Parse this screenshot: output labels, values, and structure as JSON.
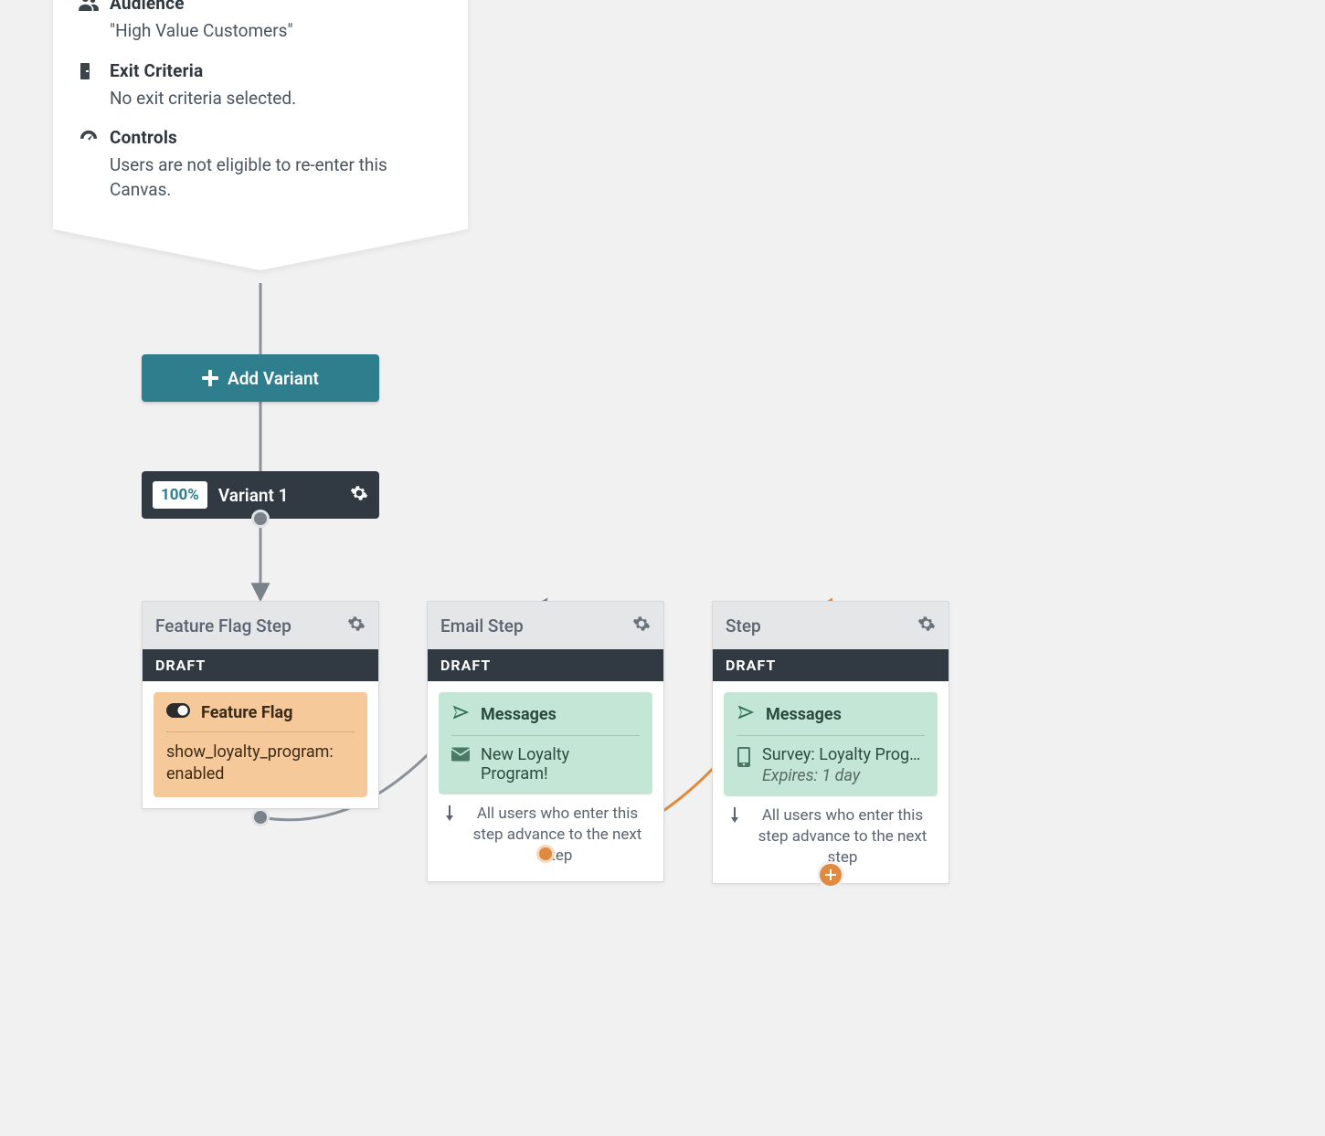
{
  "canvas": {
    "audience": {
      "label": "Audience",
      "value": "\"High Value Customers\""
    },
    "exit": {
      "label": "Exit Criteria",
      "value": "No exit criteria selected."
    },
    "controls": {
      "label": "Controls",
      "value": "Users are not eligible to re-enter this Canvas."
    }
  },
  "buttons": {
    "add_variant": "Add Variant"
  },
  "variant": {
    "percent": "100%",
    "name": "Variant 1"
  },
  "steps": {
    "feature": {
      "title": "Feature Flag Step",
      "status": "DRAFT",
      "panel_title": "Feature Flag",
      "panel_value": "show_loyalty_program: enabled"
    },
    "email": {
      "title": "Email Step",
      "status": "DRAFT",
      "panel_title": "Messages",
      "msg_label": "New Loyalty Program!",
      "advance": "All users who enter this step advance to the next step"
    },
    "survey": {
      "title": "Step",
      "status": "DRAFT",
      "panel_title": "Messages",
      "msg_label": "Survey: Loyalty Prog…",
      "msg_sub": "Expires: 1 day",
      "advance": "All users who enter this step advance to the next step"
    }
  }
}
